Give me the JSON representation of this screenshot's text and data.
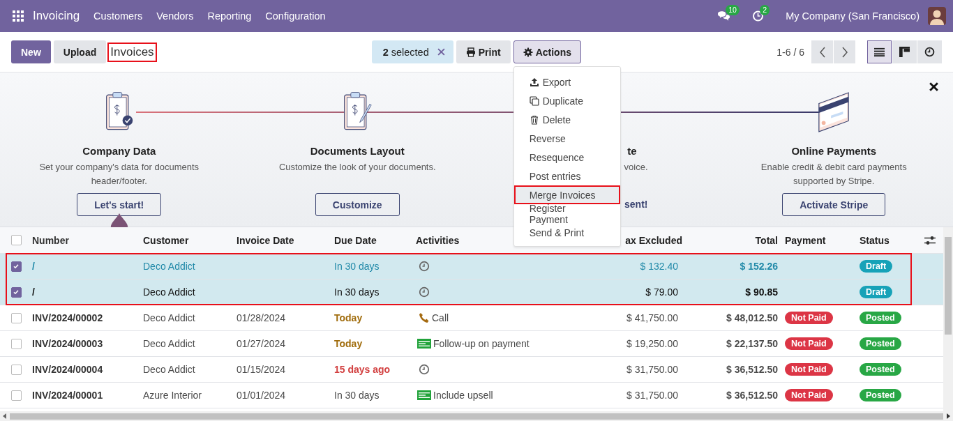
{
  "navbar": {
    "app": "Invoicing",
    "menus": [
      "Customers",
      "Vendors",
      "Reporting",
      "Configuration"
    ],
    "messages_count": "10",
    "activities_count": "2",
    "company": "My Company (San Francisco)"
  },
  "control_bar": {
    "new_button": "New",
    "upload_button": "Upload",
    "breadcrumb": {
      "text": "Invoices",
      "highlighted": true
    },
    "selection": "**2** selected",
    "print_button": "Print",
    "actions_button": {
      "label": "Actions",
      "open": true
    },
    "pager": "1-6 / 6",
    "views": [
      {
        "kind": "list",
        "selected": true
      },
      {
        "kind": "kanban",
        "selected": false
      },
      {
        "kind": "activity",
        "selected": false
      }
    ]
  },
  "onboarding": {
    "steps": [
      {
        "kind": "done",
        "title": "Company Data",
        "description": "Set your company's data for documents header/footer.",
        "button": "Let's start!"
      },
      {
        "kind": "todo",
        "title": "Documents Layout",
        "description": "Customize the look of your documents.",
        "button": "Customize"
      },
      {
        "kind": "covered",
        "title": "te",
        "description": "voice.",
        "button": "sent!"
      },
      {
        "kind": "card",
        "title": "Online Payments",
        "description": "Enable credit & debit card payments supported by Stripe.",
        "button": "Activate Stripe"
      }
    ]
  },
  "actions_menu": [
    {
      "label": "Export",
      "kind": "export",
      "selected": false,
      "highlighted": false
    },
    {
      "label": "Duplicate",
      "kind": "duplicate",
      "selected": false,
      "highlighted": false
    },
    {
      "label": "Delete",
      "kind": "delete",
      "selected": false,
      "highlighted": false
    },
    {
      "label": "Reverse",
      "kind": "plain",
      "selected": false,
      "highlighted": false
    },
    {
      "label": "Resequence",
      "kind": "plain",
      "selected": false,
      "highlighted": false
    },
    {
      "label": "Post entries",
      "kind": "plain",
      "selected": false,
      "highlighted": false
    },
    {
      "label": "Merge Invoices",
      "kind": "plain",
      "selected": true,
      "highlighted": true
    },
    {
      "label": "Register Payment",
      "kind": "plain",
      "selected": false,
      "highlighted": false
    },
    {
      "label": "Send & Print",
      "kind": "plain",
      "selected": false,
      "highlighted": false
    }
  ],
  "table": {
    "all_selected": false,
    "columns": [
      "Number",
      "Customer",
      "Invoice Date",
      "Due Date",
      "Activities",
      "ax Excluded",
      "Total",
      "Payment",
      "Status"
    ],
    "rows": [
      {
        "checked": true,
        "hovered": true,
        "highlighted": true,
        "number": "/",
        "customer": "Deco Addict",
        "due_date": {
          "text": "In 30 days",
          "kind": "future"
        },
        "activity": {
          "kind": "clock"
        },
        "tax_excluded": "$ 132.40",
        "total": "$ 152.26",
        "status": {
          "label": "Draft",
          "kind": "draft"
        }
      },
      {
        "checked": true,
        "hovered": false,
        "highlighted": true,
        "number": "/",
        "customer": "Deco Addict",
        "due_date": {
          "text": "In 30 days",
          "kind": "future"
        },
        "activity": {
          "kind": "clock"
        },
        "tax_excluded": "$ 79.00",
        "total": "$ 90.85",
        "status": {
          "label": "Draft",
          "kind": "draft"
        }
      },
      {
        "checked": false,
        "hovered": false,
        "highlighted": false,
        "number": "INV/2024/00002",
        "customer": "Deco Addict",
        "invoice_date": "01/28/2024",
        "due_date": {
          "text": "Today",
          "kind": "today"
        },
        "activity": {
          "kind": "phone",
          "label": "Call"
        },
        "tax_excluded": "$ 41,750.00",
        "total": "$ 48,012.50",
        "payment": {
          "label": "Not Paid",
          "kind": "not-paid"
        },
        "status": {
          "label": "Posted",
          "kind": "posted"
        }
      },
      {
        "checked": false,
        "hovered": false,
        "highlighted": false,
        "number": "INV/2024/00003",
        "customer": "Deco Addict",
        "invoice_date": "01/27/2024",
        "due_date": {
          "text": "Today",
          "kind": "today"
        },
        "activity": {
          "kind": "money",
          "label": "Follow-up on payment"
        },
        "tax_excluded": "$ 19,250.00",
        "total": "$ 22,137.50",
        "payment": {
          "label": "Not Paid",
          "kind": "not-paid"
        },
        "status": {
          "label": "Posted",
          "kind": "posted"
        }
      },
      {
        "checked": false,
        "hovered": false,
        "highlighted": false,
        "number": "INV/2024/00004",
        "customer": "Deco Addict",
        "invoice_date": "01/15/2024",
        "due_date": {
          "text": "15 days ago",
          "kind": "overdue"
        },
        "activity": {
          "kind": "clock"
        },
        "tax_excluded": "$ 31,750.00",
        "total": "$ 36,512.50",
        "payment": {
          "label": "Not Paid",
          "kind": "not-paid"
        },
        "status": {
          "label": "Posted",
          "kind": "posted"
        }
      },
      {
        "checked": false,
        "hovered": false,
        "highlighted": false,
        "number": "INV/2024/00001",
        "customer": "Azure Interior",
        "invoice_date": "01/01/2024",
        "due_date": {
          "text": "In 30 days",
          "kind": "future"
        },
        "activity": {
          "kind": "money",
          "label": "Include upsell"
        },
        "tax_excluded": "$ 31,750.00",
        "total": "$ 36,512.50",
        "payment": {
          "label": "Not Paid",
          "kind": "not-paid"
        },
        "status": {
          "label": "Posted",
          "kind": "posted"
        }
      }
    ]
  }
}
